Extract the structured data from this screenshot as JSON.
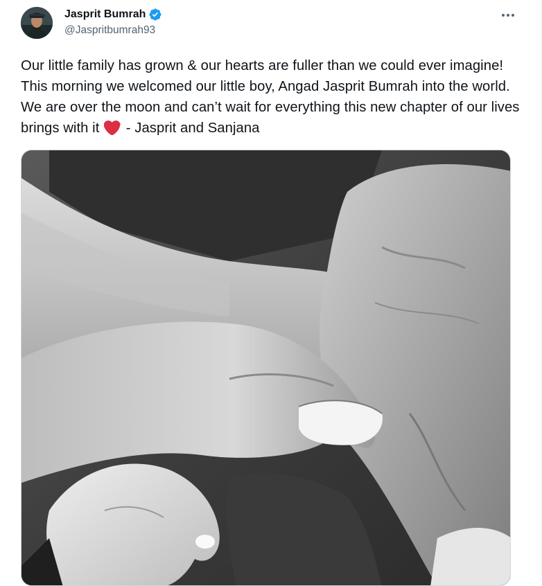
{
  "author": {
    "display_name": "Jasprit Bumrah",
    "handle": "@Jaspritbumrah93",
    "verified": true,
    "avatar_icon": "profile-avatar"
  },
  "more_menu": {
    "icon": "more-horizontal-icon"
  },
  "tweet": {
    "text_before_emoji": "Our little family has grown & our hearts are fuller than we could ever imagine! This morning we welcomed our little boy, Angad Jasprit Bumrah into the world. We are over the moon and can’t wait for everything this new chapter of our lives brings with it ",
    "emoji": "red-heart",
    "text_after_emoji": " - Jasprit and Sanjana"
  },
  "media": {
    "type": "photo",
    "style": "black-and-white",
    "subject": "hands"
  },
  "colors": {
    "text_primary": "#0f1419",
    "text_secondary": "#536471",
    "verified_blue": "#1d9bf0",
    "heart_red": "#e0245e",
    "border": "#cfd9de"
  }
}
